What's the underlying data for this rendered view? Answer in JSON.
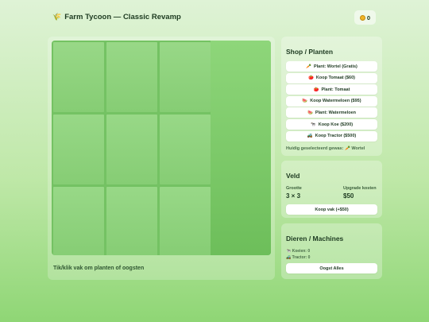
{
  "header": {
    "title_icon": "🌾",
    "title": "Farm Tycoon — Classic Revamp",
    "coins_icon": "coin-icon",
    "coins": "0"
  },
  "board": {
    "rows": 3,
    "cols": 3,
    "hint": "Tik/klik vak om planten of oogsten"
  },
  "shop": {
    "title": "Shop / Planten",
    "buttons": [
      {
        "icon": "🥕",
        "label": "Plant: Wortel (Gratis)"
      },
      {
        "icon": "🍅",
        "label": "Koop Tomaat ($60)"
      },
      {
        "icon": "🍅",
        "label": "Plant: Tomaat"
      },
      {
        "icon": "🍉",
        "label": "Koop Watermeloen ($95)"
      },
      {
        "icon": "🍉",
        "label": "Plant: Watermeloen"
      },
      {
        "icon": "🐄",
        "label": "Koop Koe ($200)"
      },
      {
        "icon": "🚜",
        "label": "Koop Tractor ($500)"
      }
    ],
    "selected_text": "Huidig geselecteerd gewas: 🥕 Wortel"
  },
  "field": {
    "title": "Veld",
    "size_label": "Grootte",
    "size_value": "3 × 3",
    "upgrade_label": "Upgrade kosten",
    "upgrade_value": "$50",
    "buy_button": "Koop vak (+$50)"
  },
  "animals": {
    "title": "Dieren / Machines",
    "cows": "🐄 Koeien: 0",
    "tractors": "🚜 Tractor: 0",
    "harvest_button": "Oogst Alles"
  }
}
